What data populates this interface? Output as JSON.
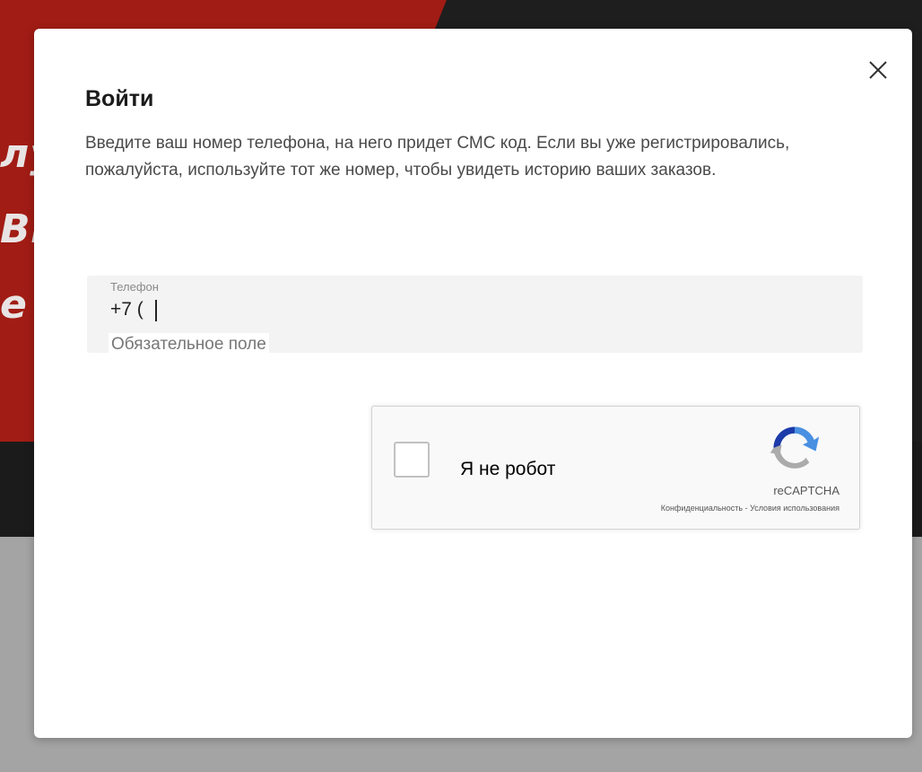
{
  "background": {
    "ghost_lines": [
      "лу",
      "ВЫ",
      "е"
    ]
  },
  "modal": {
    "close_icon": "close-icon",
    "title": "Войти",
    "description": "Введите ваш номер телефона, на него придет СМС код. Если вы уже регистрировались, пожалуйста, используйте тот же номер, чтобы увидеть историю ваших заказов.",
    "phone_field": {
      "label": "Телефон",
      "value": "+7 (",
      "error": "Обязательное поле"
    },
    "recaptcha": {
      "label": "Я не робот",
      "brand": "reCAPTCHA",
      "privacy_link": "Конфиденциальность",
      "separator": " - ",
      "terms_link": "Условия использования"
    }
  },
  "colors": {
    "background_red": "#a11c14",
    "background_dark": "#1e1e1e",
    "overlay_gray": "#a4a4a4",
    "modal_bg": "#ffffff",
    "field_bg": "#f3f3f3"
  }
}
